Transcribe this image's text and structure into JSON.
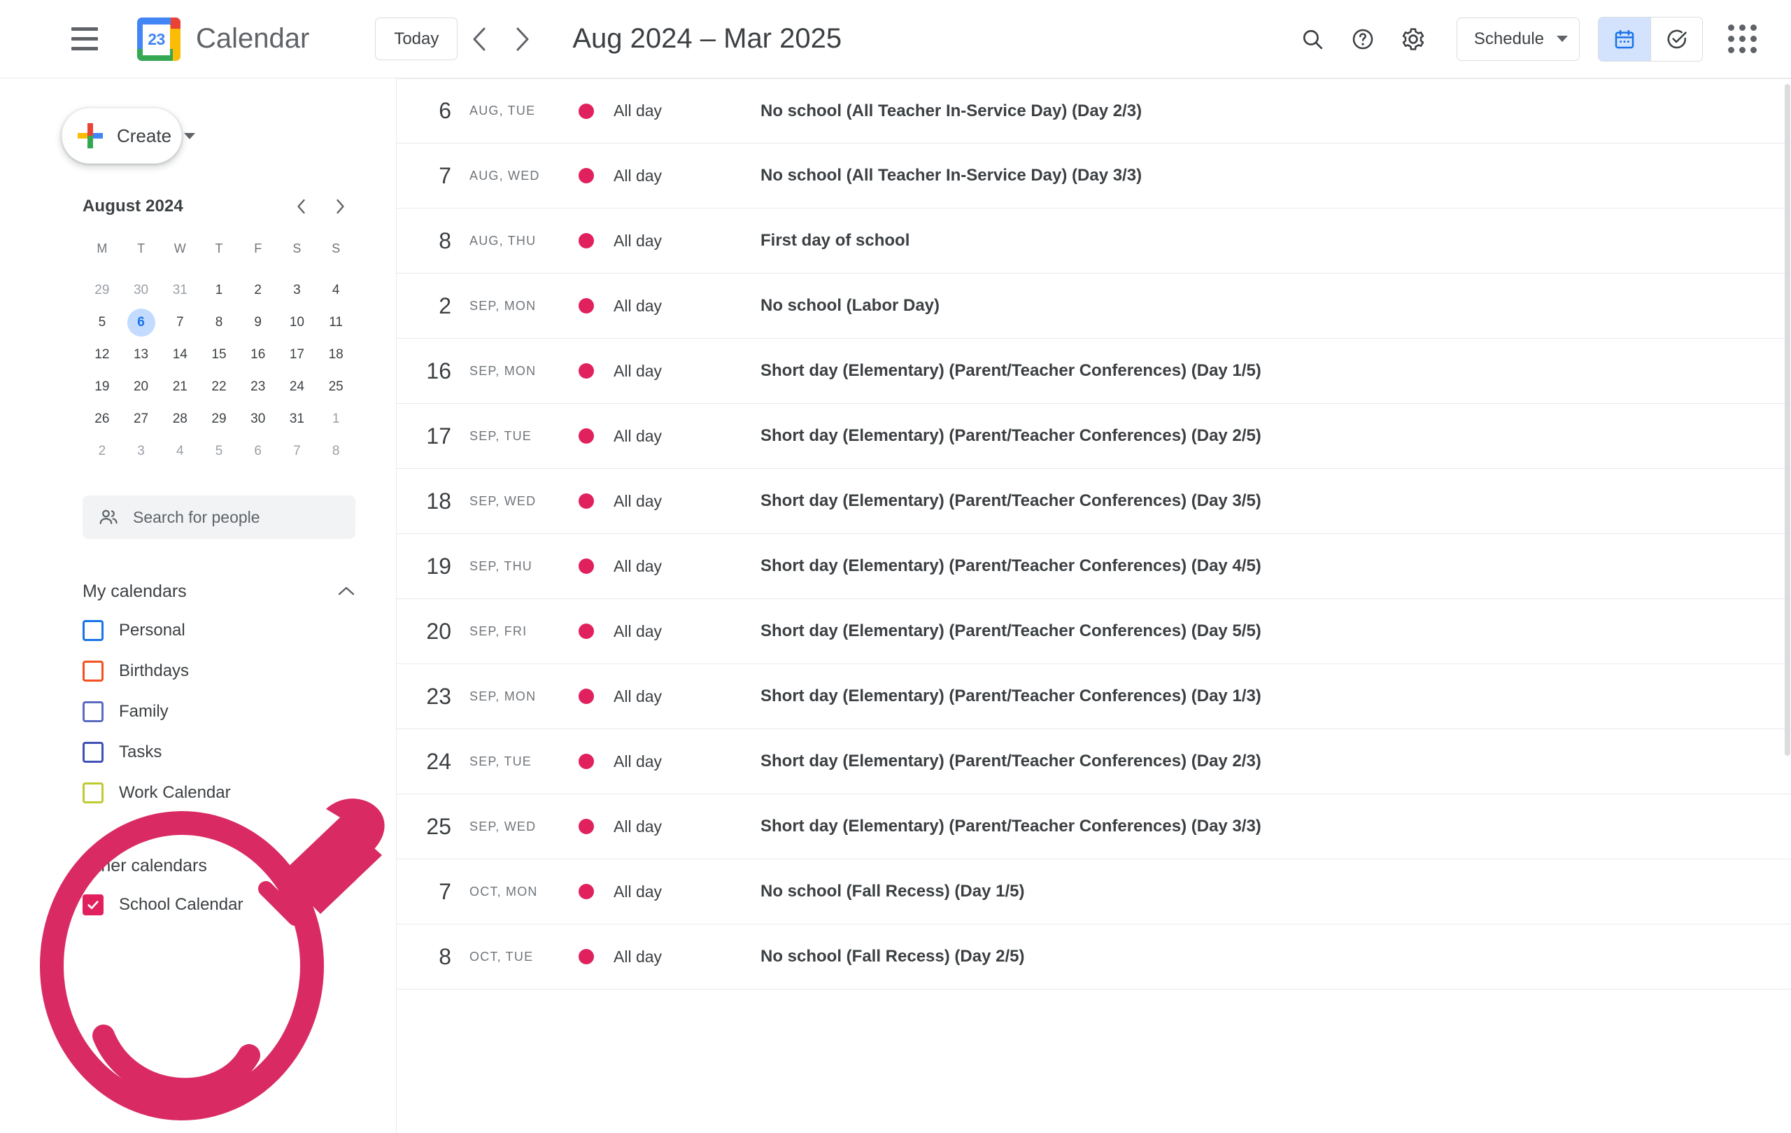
{
  "header": {
    "menu_icon": "hamburger-menu-icon",
    "logo_day": "23",
    "brand": "Calendar",
    "today_label": "Today",
    "prev_icon": "chevron-left-icon",
    "next_icon": "chevron-right-icon",
    "date_range": "Aug 2024 – Mar 2025",
    "search_icon": "search-icon",
    "help_icon": "help-circle-icon",
    "settings_icon": "gear-icon",
    "view_selected": "Schedule",
    "view_caret_icon": "chevron-down-icon",
    "calendar_toggle_icon": "calendar-icon",
    "tasks_toggle_icon": "tasks-check-icon",
    "apps_icon": "apps-grid-icon"
  },
  "sidebar": {
    "create_label": "Create",
    "create_plus_icon": "google-plus-icon",
    "create_caret_icon": "chevron-down-icon",
    "mini_calendar": {
      "title": "August 2024",
      "prev_icon": "chevron-left-icon",
      "next_icon": "chevron-right-icon",
      "dow": [
        "M",
        "T",
        "W",
        "T",
        "F",
        "S",
        "S"
      ],
      "weeks": [
        [
          {
            "d": "29",
            "muted": true
          },
          {
            "d": "30",
            "muted": true
          },
          {
            "d": "31",
            "muted": true
          },
          {
            "d": "1"
          },
          {
            "d": "2"
          },
          {
            "d": "3"
          },
          {
            "d": "4"
          }
        ],
        [
          {
            "d": "5"
          },
          {
            "d": "6",
            "today": true
          },
          {
            "d": "7"
          },
          {
            "d": "8"
          },
          {
            "d": "9"
          },
          {
            "d": "10"
          },
          {
            "d": "11"
          }
        ],
        [
          {
            "d": "12"
          },
          {
            "d": "13"
          },
          {
            "d": "14"
          },
          {
            "d": "15"
          },
          {
            "d": "16"
          },
          {
            "d": "17"
          },
          {
            "d": "18"
          }
        ],
        [
          {
            "d": "19"
          },
          {
            "d": "20"
          },
          {
            "d": "21"
          },
          {
            "d": "22"
          },
          {
            "d": "23"
          },
          {
            "d": "24"
          },
          {
            "d": "25"
          }
        ],
        [
          {
            "d": "26"
          },
          {
            "d": "27"
          },
          {
            "d": "28"
          },
          {
            "d": "29"
          },
          {
            "d": "30"
          },
          {
            "d": "31"
          },
          {
            "d": "1",
            "muted": true
          }
        ],
        [
          {
            "d": "2",
            "muted": true
          },
          {
            "d": "3",
            "muted": true
          },
          {
            "d": "4",
            "muted": true
          },
          {
            "d": "5",
            "muted": true
          },
          {
            "d": "6",
            "muted": true
          },
          {
            "d": "7",
            "muted": true
          },
          {
            "d": "8",
            "muted": true
          }
        ]
      ]
    },
    "people_search": {
      "icon": "people-icon",
      "placeholder": "Search for people"
    },
    "my_calendars": {
      "title": "My calendars",
      "collapse_icon": "chevron-up-icon",
      "items": [
        {
          "label": "Personal",
          "color": "#1a73e8",
          "checked": false
        },
        {
          "label": "Birthdays",
          "color": "#f4511e",
          "checked": false
        },
        {
          "label": "Family",
          "color": "#5c6bc0",
          "checked": false
        },
        {
          "label": "Tasks",
          "color": "#3f51b5",
          "checked": false
        },
        {
          "label": "Work Calendar",
          "color": "#c0ca33",
          "checked": false
        }
      ]
    },
    "other_calendars": {
      "title": "Other calendars",
      "add_icon": "plus-icon",
      "items": [
        {
          "label": "School Calendar",
          "color": "#e0215e",
          "checked": true
        }
      ]
    }
  },
  "main": {
    "all_day_label": "All day",
    "event_dot_color": "#e0215e",
    "events": [
      {
        "day": "6",
        "weekday": "AUG, TUE",
        "time": "All day",
        "title": "No school (All Teacher In-Service Day) (Day 2/3)"
      },
      {
        "day": "7",
        "weekday": "AUG, WED",
        "time": "All day",
        "title": "No school (All Teacher In-Service Day) (Day 3/3)"
      },
      {
        "day": "8",
        "weekday": "AUG, THU",
        "time": "All day",
        "title": "First day of school"
      },
      {
        "day": "2",
        "weekday": "SEP, MON",
        "time": "All day",
        "title": "No school (Labor Day)"
      },
      {
        "day": "16",
        "weekday": "SEP, MON",
        "time": "All day",
        "title": "Short day (Elementary) (Parent/Teacher Conferences) (Day 1/5)"
      },
      {
        "day": "17",
        "weekday": "SEP, TUE",
        "time": "All day",
        "title": "Short day (Elementary) (Parent/Teacher Conferences) (Day 2/5)"
      },
      {
        "day": "18",
        "weekday": "SEP, WED",
        "time": "All day",
        "title": "Short day (Elementary) (Parent/Teacher Conferences) (Day 3/5)"
      },
      {
        "day": "19",
        "weekday": "SEP, THU",
        "time": "All day",
        "title": "Short day (Elementary) (Parent/Teacher Conferences) (Day 4/5)"
      },
      {
        "day": "20",
        "weekday": "SEP, FRI",
        "time": "All day",
        "title": "Short day (Elementary) (Parent/Teacher Conferences) (Day 5/5)"
      },
      {
        "day": "23",
        "weekday": "SEP, MON",
        "time": "All day",
        "title": "Short day (Elementary) (Parent/Teacher Conferences) (Day 1/3)"
      },
      {
        "day": "24",
        "weekday": "SEP, TUE",
        "time": "All day",
        "title": "Short day (Elementary) (Parent/Teacher Conferences) (Day 2/3)"
      },
      {
        "day": "25",
        "weekday": "SEP, WED",
        "time": "All day",
        "title": "Short day (Elementary) (Parent/Teacher Conferences) (Day 3/3)"
      },
      {
        "day": "7",
        "weekday": "OCT, MON",
        "time": "All day",
        "title": "No school (Fall Recess) (Day 1/5)"
      },
      {
        "day": "8",
        "weekday": "OCT, TUE",
        "time": "All day",
        "title": "No school (Fall Recess) (Day 2/5)"
      }
    ]
  },
  "annotation": {
    "name": "magnifier-highlight-annotation",
    "color": "#d92a63"
  }
}
